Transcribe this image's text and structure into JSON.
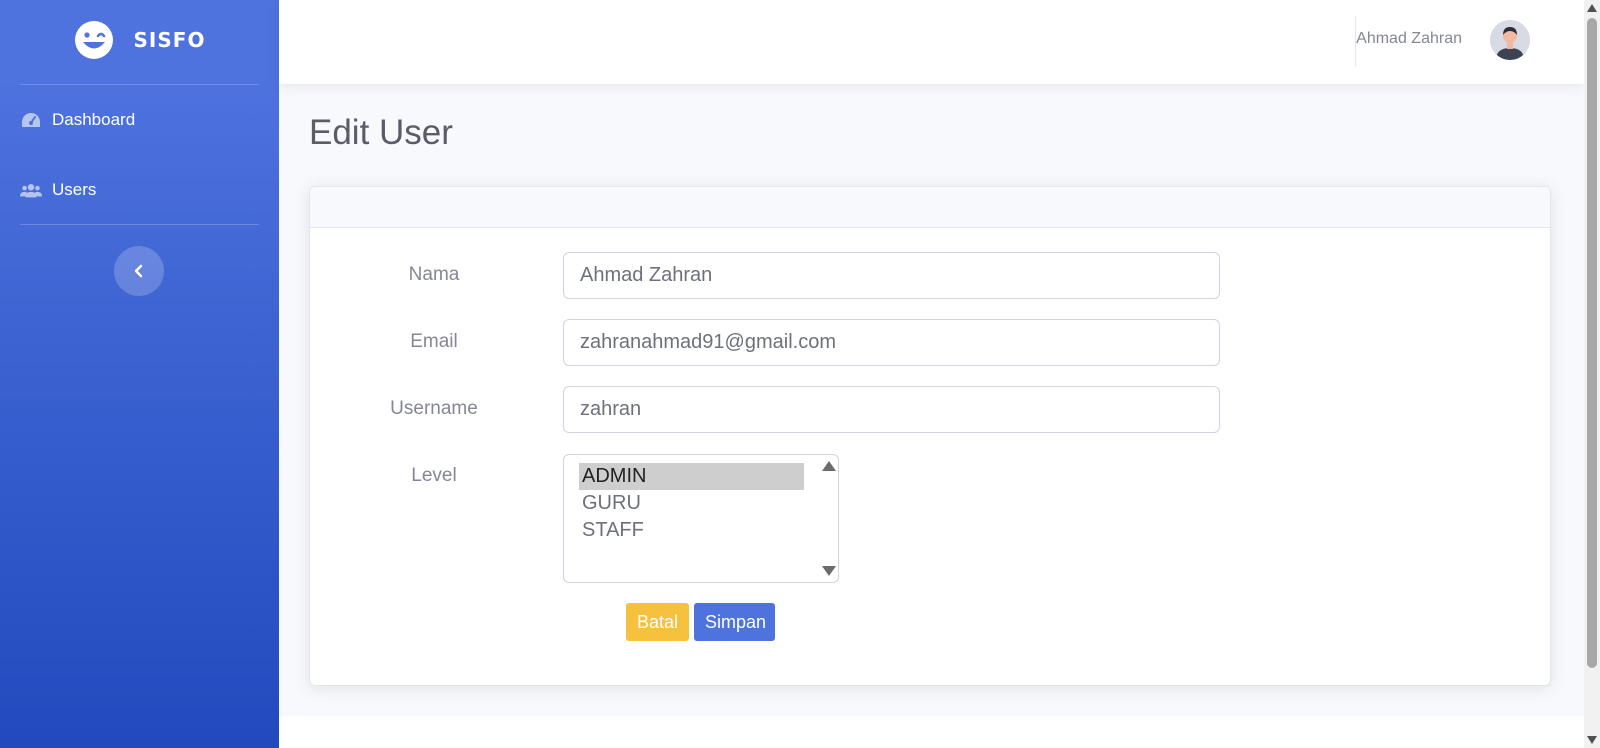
{
  "sidebar": {
    "brand": "SISFO",
    "items": [
      {
        "label": "Dashboard",
        "icon": "tachometer-icon"
      },
      {
        "label": "Users",
        "icon": "users-icon"
      }
    ],
    "toggle_icon": "chevron-left-icon"
  },
  "topbar": {
    "user_name": "Ahmad Zahran",
    "avatar_icon": "user-avatar"
  },
  "page": {
    "title": "Edit User"
  },
  "form": {
    "name_label": "Nama",
    "name_value": "Ahmad Zahran",
    "email_label": "Email",
    "email_value": "zahranahmad91@gmail.com",
    "username_label": "Username",
    "username_value": "zahran",
    "level_label": "Level",
    "level_options": [
      "ADMIN",
      "GURU",
      "STAFF"
    ],
    "level_selected": "ADMIN",
    "cancel_label": "Batal",
    "save_label": "Simpan"
  },
  "colors": {
    "primary": "#4e73df",
    "warning": "#f6c23e",
    "sidebar_gradient_end": "#224abe"
  }
}
